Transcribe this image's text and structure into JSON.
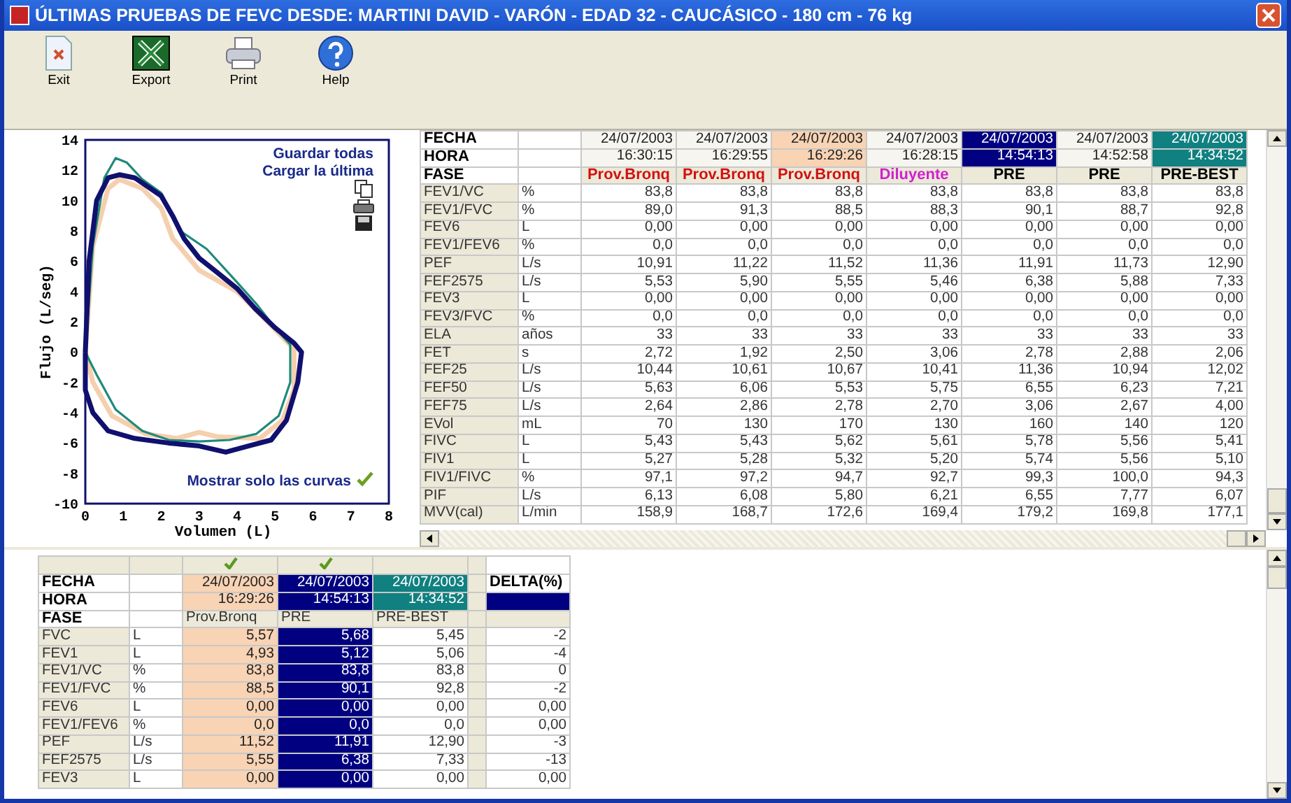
{
  "window": {
    "title": "ÚLTIMAS PRUEBAS DE  FEVC DESDE: MARTINI DAVID - VARÓN  - EDAD 32 - CAUCÁSICO - 180 cm - 76 kg"
  },
  "toolbar": [
    {
      "kind": "exit",
      "label": "Exit"
    },
    {
      "kind": "export",
      "label": "Export"
    },
    {
      "kind": "print",
      "label": "Print"
    },
    {
      "kind": "help",
      "label": "Help"
    }
  ],
  "chart": {
    "links": [
      "Guardar todas",
      "Cargar la última"
    ],
    "curves_only": {
      "label": "Mostrar solo las curvas",
      "checked": true
    },
    "plot": {
      "xlabel": "Volumen (L)",
      "ylabel": "Flujo (L/seg)",
      "xticks": [
        "0",
        "1",
        "2",
        "3",
        "4",
        "5",
        "6",
        "7",
        "8"
      ],
      "yticks": [
        "14",
        "12",
        "10",
        "8",
        "6",
        "4",
        "2",
        "0",
        "-2",
        "-4",
        "-6",
        "-8",
        "-10"
      ],
      "curves": [
        {
          "color": "#f5cfae"
        },
        {
          "color": "#1f8a7a"
        },
        {
          "color": "#10106e"
        }
      ]
    }
  },
  "tests_table": {
    "header_labels": [
      "FECHA",
      "HORA",
      "FASE"
    ],
    "columns": [
      {
        "date": "24/07/2003",
        "time": "16:30:15",
        "phase": {
          "text": "Prov.Bronq",
          "color": "#d41010"
        }
      },
      {
        "date": "24/07/2003",
        "time": "16:29:55",
        "phase": {
          "text": "Prov.Bronq",
          "color": "#d41010"
        }
      },
      {
        "date": "24/07/2003",
        "time": "16:29:26",
        "color": "#f8d3b4",
        "phase": {
          "text": "Prov.Bronq",
          "color": "#d41010"
        }
      },
      {
        "date": "24/07/2003",
        "time": "16:28:15",
        "phase": {
          "text": "Diluyente",
          "color": "#d020d0"
        }
      },
      {
        "date": "24/07/2003",
        "time": "14:54:13",
        "color": "#000080",
        "phase": {
          "text": "PRE",
          "color": "#000000"
        }
      },
      {
        "date": "24/07/2003",
        "time": "14:52:58",
        "phase": {
          "text": "PRE",
          "color": "#000000"
        }
      },
      {
        "date": "24/07/2003",
        "time": "14:34:52",
        "color": "#108080",
        "phase": {
          "text": "PRE-BEST",
          "color": "#000000"
        }
      }
    ],
    "rows": [
      {
        "label": "FEV1/VC",
        "unit": "%",
        "values": [
          "83,8",
          "83,8",
          "83,8",
          "83,8",
          "83,8",
          "83,8",
          "83,8"
        ]
      },
      {
        "label": "FEV1/FVC",
        "unit": "%",
        "values": [
          "89,0",
          "91,3",
          "88,5",
          "88,3",
          "90,1",
          "88,7",
          "92,8"
        ]
      },
      {
        "label": "FEV6",
        "unit": "L",
        "values": [
          "0,00",
          "0,00",
          "0,00",
          "0,00",
          "0,00",
          "0,00",
          "0,00"
        ]
      },
      {
        "label": "FEV1/FEV6",
        "unit": "%",
        "values": [
          "0,0",
          "0,0",
          "0,0",
          "0,0",
          "0,0",
          "0,0",
          "0,0"
        ]
      },
      {
        "label": "PEF",
        "unit": "L/s",
        "values": [
          "10,91",
          "11,22",
          "11,52",
          "11,36",
          "11,91",
          "11,73",
          "12,90"
        ]
      },
      {
        "label": "FEF2575",
        "unit": "L/s",
        "values": [
          "5,53",
          "5,90",
          "5,55",
          "5,46",
          "6,38",
          "5,88",
          "7,33"
        ]
      },
      {
        "label": "FEV3",
        "unit": "L",
        "values": [
          "0,00",
          "0,00",
          "0,00",
          "0,00",
          "0,00",
          "0,00",
          "0,00"
        ]
      },
      {
        "label": "FEV3/FVC",
        "unit": "%",
        "values": [
          "0,0",
          "0,0",
          "0,0",
          "0,0",
          "0,0",
          "0,0",
          "0,0"
        ]
      },
      {
        "label": "ELA",
        "unit": "años",
        "values": [
          "33",
          "33",
          "33",
          "33",
          "33",
          "33",
          "33"
        ]
      },
      {
        "label": "FET",
        "unit": "s",
        "values": [
          "2,72",
          "1,92",
          "2,50",
          "3,06",
          "2,78",
          "2,88",
          "2,06"
        ]
      },
      {
        "label": "FEF25",
        "unit": "L/s",
        "values": [
          "10,44",
          "10,61",
          "10,67",
          "10,41",
          "11,36",
          "10,94",
          "12,02"
        ]
      },
      {
        "label": "FEF50",
        "unit": "L/s",
        "values": [
          "5,63",
          "6,06",
          "5,53",
          "5,75",
          "6,55",
          "6,23",
          "7,21"
        ]
      },
      {
        "label": "FEF75",
        "unit": "L/s",
        "values": [
          "2,64",
          "2,86",
          "2,78",
          "2,70",
          "3,06",
          "2,67",
          "4,00"
        ]
      },
      {
        "label": "EVol",
        "unit": "mL",
        "values": [
          "70",
          "130",
          "170",
          "130",
          "160",
          "140",
          "120"
        ]
      },
      {
        "label": "FIVC",
        "unit": "L",
        "values": [
          "5,43",
          "5,43",
          "5,62",
          "5,61",
          "5,78",
          "5,56",
          "5,41"
        ]
      },
      {
        "label": "FIV1",
        "unit": "L",
        "values": [
          "5,27",
          "5,28",
          "5,32",
          "5,20",
          "5,74",
          "5,56",
          "5,10"
        ]
      },
      {
        "label": "FIV1/FIVC",
        "unit": "%",
        "values": [
          "97,1",
          "97,2",
          "94,7",
          "92,7",
          "99,3",
          "100,0",
          "94,3"
        ]
      },
      {
        "label": "PIF",
        "unit": "L/s",
        "values": [
          "6,13",
          "6,08",
          "5,80",
          "6,21",
          "6,55",
          "7,77",
          "6,07"
        ]
      },
      {
        "label": "MVV(cal)",
        "unit": "L/min",
        "values": [
          "158,9",
          "168,7",
          "172,6",
          "169,4",
          "179,2",
          "169,8",
          "177,1"
        ]
      }
    ]
  },
  "compare_table": {
    "header_labels": [
      "FECHA",
      "HORA",
      "FASE"
    ],
    "columns": [
      {
        "checked": true,
        "date": "24/07/2003",
        "time": "16:29:26",
        "phase": "Prov.Bronq",
        "color": "#f8d3b4",
        "body_filled": true
      },
      {
        "checked": true,
        "date": "24/07/2003",
        "time": "14:54:13",
        "phase": "PRE",
        "color": "#000080",
        "body_filled": true
      },
      {
        "checked": false,
        "date": "24/07/2003",
        "time": "14:34:52",
        "phase": "PRE-BEST",
        "color": "#108080",
        "body_filled": false
      }
    ],
    "delta": {
      "header": "DELTA(%)",
      "color": "#000080"
    },
    "rows": [
      {
        "label": "FVC",
        "unit": "L",
        "values": [
          "5,57",
          "5,68",
          "5,45"
        ],
        "delta": "-2"
      },
      {
        "label": "FEV1",
        "unit": "L",
        "values": [
          "4,93",
          "5,12",
          "5,06"
        ],
        "delta": "-4"
      },
      {
        "label": "FEV1/VC",
        "unit": "%",
        "values": [
          "83,8",
          "83,8",
          "83,8"
        ],
        "delta": "0"
      },
      {
        "label": "FEV1/FVC",
        "unit": "%",
        "values": [
          "88,5",
          "90,1",
          "92,8"
        ],
        "delta": "-2"
      },
      {
        "label": "FEV6",
        "unit": "L",
        "values": [
          "0,00",
          "0,00",
          "0,00"
        ],
        "delta": "0,00"
      },
      {
        "label": "FEV1/FEV6",
        "unit": "%",
        "values": [
          "0,0",
          "0,0",
          "0,0"
        ],
        "delta": "0,00"
      },
      {
        "label": "PEF",
        "unit": "L/s",
        "values": [
          "11,52",
          "11,91",
          "12,90"
        ],
        "delta": "-3"
      },
      {
        "label": "FEF2575",
        "unit": "L/s",
        "values": [
          "5,55",
          "6,38",
          "7,33"
        ],
        "delta": "-13"
      },
      {
        "label": "FEV3",
        "unit": "L",
        "values": [
          "0,00",
          "0,00",
          "0,00"
        ],
        "delta": "0,00"
      }
    ]
  }
}
